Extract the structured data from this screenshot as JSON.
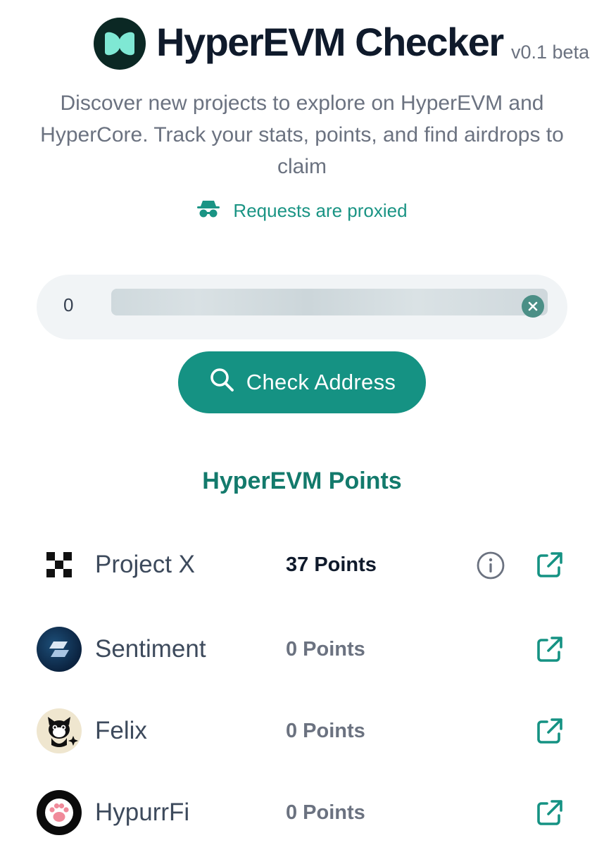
{
  "header": {
    "title": "HyperEVM Checker",
    "version": "v0.1 beta",
    "description": "Discover new projects to explore on HyperEVM and HyperCore. Track your stats, points, and find airdrops to claim",
    "proxy_note": "Requests are proxied"
  },
  "search": {
    "address_value": "0",
    "button_label": "Check Address"
  },
  "section": {
    "title": "HyperEVM Points"
  },
  "projects": [
    {
      "name": "Project X",
      "points": "37 Points",
      "icon": "project-x-logo",
      "has_info": true
    },
    {
      "name": "Sentiment",
      "points": "0 Points",
      "icon": "sentiment-logo",
      "has_info": false
    },
    {
      "name": "Felix",
      "points": "0 Points",
      "icon": "felix-logo",
      "has_info": false
    },
    {
      "name": "HypurrFi",
      "points": "0 Points",
      "icon": "hypurrfi-logo",
      "has_info": false
    }
  ],
  "colors": {
    "accent": "#159283",
    "accent_dark": "#137a6c",
    "title": "#0f1a2b",
    "muted": "#6b7280"
  }
}
